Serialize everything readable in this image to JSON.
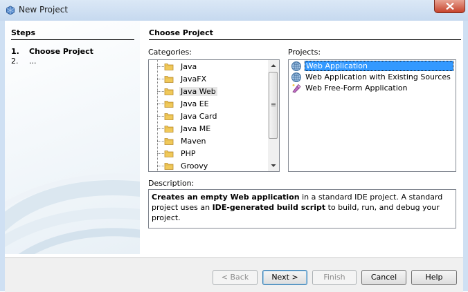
{
  "window": {
    "title": "New Project"
  },
  "steps": {
    "title": "Steps",
    "items": [
      {
        "num": "1.",
        "label": "Choose Project"
      },
      {
        "num": "2.",
        "label": "..."
      }
    ]
  },
  "main": {
    "title": "Choose Project",
    "categories_label": "Categories:",
    "projects_label": "Projects:",
    "description_label": "Description:"
  },
  "categories": [
    {
      "label": "Java",
      "icon": "folder-icon"
    },
    {
      "label": "JavaFX",
      "icon": "folder-icon"
    },
    {
      "label": "Java Web",
      "icon": "folder-icon",
      "selected": true
    },
    {
      "label": "Java EE",
      "icon": "folder-icon"
    },
    {
      "label": "Java Card",
      "icon": "folder-icon"
    },
    {
      "label": "Java ME",
      "icon": "folder-icon"
    },
    {
      "label": "Maven",
      "icon": "folder-icon"
    },
    {
      "label": "PHP",
      "icon": "folder-icon"
    },
    {
      "label": "Groovy",
      "icon": "folder-icon"
    }
  ],
  "projects": [
    {
      "label": "Web Application",
      "icon": "globe-icon",
      "selected": true
    },
    {
      "label": "Web Application with Existing Sources",
      "icon": "globe-icon"
    },
    {
      "label": "Web Free-Form Application",
      "icon": "free-form-icon"
    }
  ],
  "description": {
    "bold1": "Creates an empty Web application",
    "text1": " in a standard IDE project. A standard project uses an ",
    "bold2": "IDE-generated build script",
    "text2": " to build, run, and debug your project."
  },
  "buttons": {
    "back": "< Back",
    "next": "Next >",
    "finish": "Finish",
    "cancel": "Cancel",
    "help": "Help"
  },
  "colors": {
    "selection": "#3399ff",
    "close_button": "#c7432c",
    "title_bar": "#c6d9ef"
  }
}
